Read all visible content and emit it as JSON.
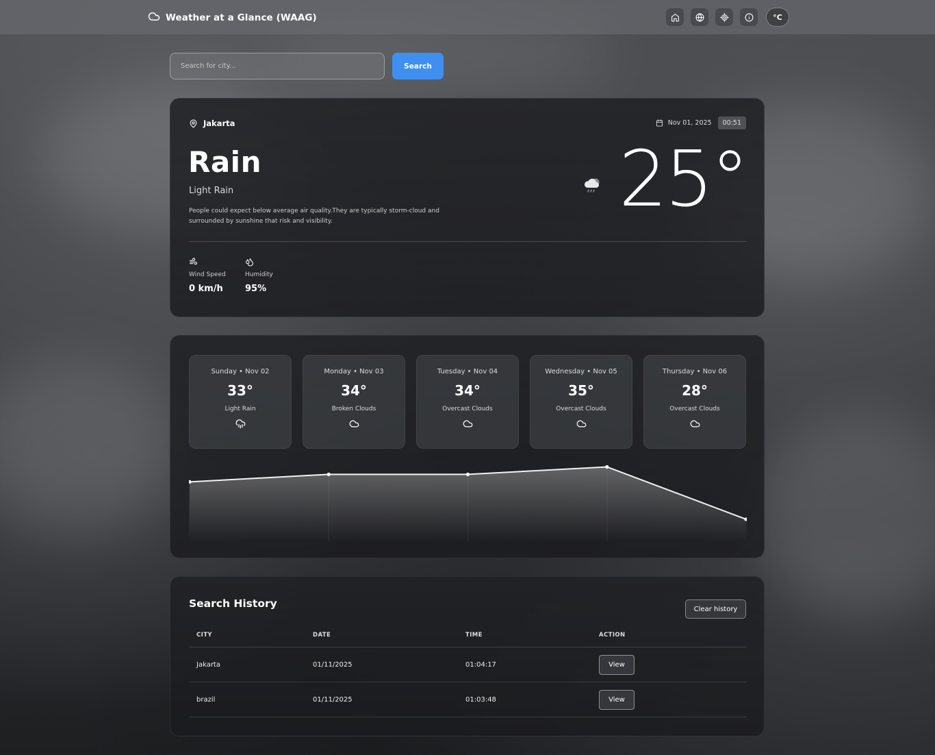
{
  "header": {
    "title": "Weather at a Glance (WAAG)",
    "nav_icons": [
      "home-icon",
      "globe-icon",
      "locate-icon",
      "info-icon"
    ],
    "unit_label": "°C"
  },
  "search": {
    "placeholder": "Search for city...",
    "button_label": "Search"
  },
  "current": {
    "location": "Jakarta",
    "date": "Nov 01, 2025",
    "time": "00:51",
    "condition": "Rain",
    "condition_detail": "Light Rain",
    "description": "People could expect below average air quality.They are typically storm-cloud and surrounded by sunshine that risk and visibility.",
    "temperature": "25°",
    "icon": "cloud-rain-icon",
    "wind_label": "Wind Speed",
    "wind_value": "0 km/h",
    "humidity_label": "Humidity",
    "humidity_value": "95%"
  },
  "forecast": {
    "days": [
      {
        "label": "Sunday • Nov 02",
        "temp": "33°",
        "condition": "Light Rain",
        "icon": "cloud-rain-icon"
      },
      {
        "label": "Monday • Nov 03",
        "temp": "34°",
        "condition": "Broken Clouds",
        "icon": "cloud-icon"
      },
      {
        "label": "Tuesday • Nov 04",
        "temp": "34°",
        "condition": "Overcast Clouds",
        "icon": "cloud-icon"
      },
      {
        "label": "Wednesday • Nov 05",
        "temp": "35°",
        "condition": "Overcast Clouds",
        "icon": "cloud-icon"
      },
      {
        "label": "Thursday • Nov 06",
        "temp": "28°",
        "condition": "Overcast Clouds",
        "icon": "cloud-icon"
      }
    ]
  },
  "chart_data": {
    "type": "area",
    "x": [
      "Sunday • Nov 02",
      "Monday • Nov 03",
      "Tuesday • Nov 04",
      "Wednesday • Nov 05",
      "Thursday • Nov 06"
    ],
    "values": [
      33,
      34,
      34,
      35,
      28
    ],
    "title": "",
    "xlabel": "",
    "ylabel": "",
    "ylim": [
      25.8,
      35.5
    ],
    "grid": false
  },
  "history": {
    "title": "Search History",
    "clear_label": "Clear history",
    "columns": [
      "CITY",
      "DATE",
      "TIME",
      "ACTION"
    ],
    "rows": [
      {
        "city": "Jakarta",
        "date": "01/11/2025",
        "time": "01:04:17",
        "action": "View"
      },
      {
        "city": "brazil",
        "date": "01/11/2025",
        "time": "01:03:48",
        "action": "View"
      }
    ]
  }
}
